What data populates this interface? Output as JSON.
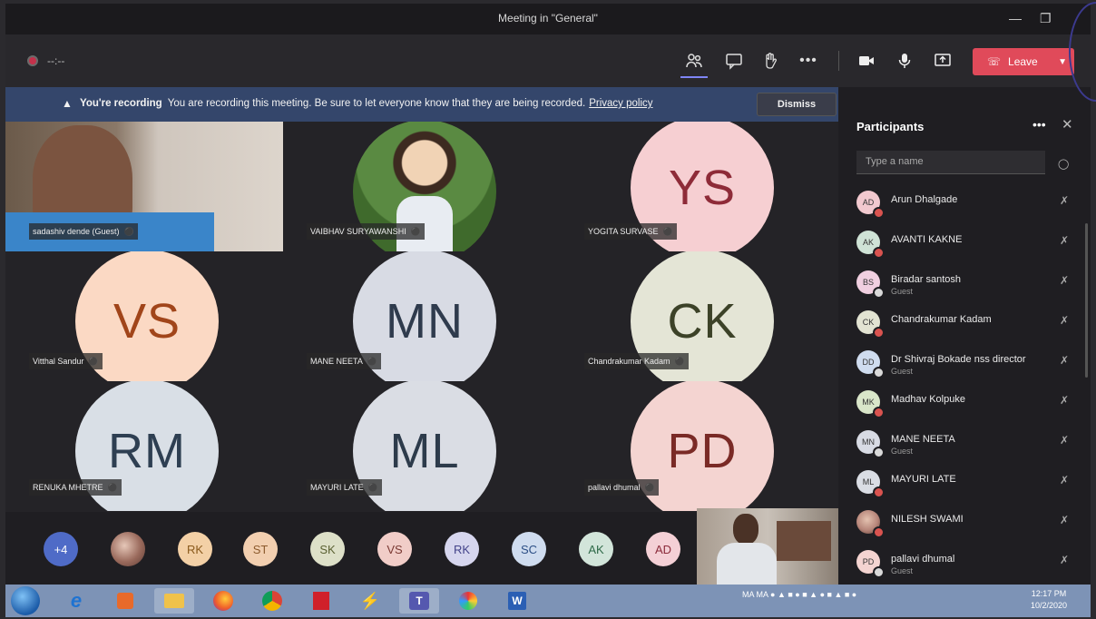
{
  "window": {
    "title": "Meeting in \"General\""
  },
  "toolbar": {
    "leave_label": "Leave"
  },
  "banner": {
    "heading": "You're recording",
    "message": "You are recording this meeting. Be sure to let everyone know that they are being recorded.",
    "link": "Privacy policy",
    "dismiss": "Dismiss"
  },
  "tiles": [
    {
      "name": "sadashiv dende (Guest)",
      "type": "video"
    },
    {
      "name": "VAIBHAV SURYAWANSHI",
      "type": "photo"
    },
    {
      "name": "YOGITA SURVASE",
      "initials": "YS",
      "bg": "#f6cfd2",
      "fg": "#8e2b38"
    },
    {
      "name": "Vitthal Sandur",
      "initials": "VS",
      "bg": "#fbd9c4",
      "fg": "#a1451a"
    },
    {
      "name": "MANE NEETA",
      "initials": "MN",
      "bg": "#d8dbe4",
      "fg": "#2f3b4d"
    },
    {
      "name": "Chandrakumar Kadam",
      "initials": "CK",
      "bg": "#e4e5d6",
      "fg": "#3c4228"
    },
    {
      "name": "RENUKA MHETRE",
      "initials": "RM",
      "bg": "#d9dfe6",
      "fg": "#2e3f52"
    },
    {
      "name": "MAYURI LATE",
      "initials": "ML",
      "bg": "#dadde4",
      "fg": "#2d3b4b"
    },
    {
      "name": "pallavi dhumal",
      "initials": "PD",
      "bg": "#f4d4d1",
      "fg": "#7a2a26"
    }
  ],
  "tray": [
    {
      "label": "+4",
      "bg": "#4f6bc7",
      "fg": "#ffffff"
    },
    {
      "label": "",
      "bg": "#b98c7f",
      "fg": "#ffffff"
    },
    {
      "label": "RK",
      "bg": "#f3d0a6",
      "fg": "#8a5a1c"
    },
    {
      "label": "ST",
      "bg": "#f2cfb0",
      "fg": "#8c5a2d"
    },
    {
      "label": "SK",
      "bg": "#dde0c8",
      "fg": "#5b6133"
    },
    {
      "label": "VS",
      "bg": "#f1cdc8",
      "fg": "#7b3a34"
    },
    {
      "label": "RK",
      "bg": "#d6d6ee",
      "fg": "#44448a"
    },
    {
      "label": "SC",
      "bg": "#cfdcef",
      "fg": "#2d4f86"
    },
    {
      "label": "AK",
      "bg": "#d2e5da",
      "fg": "#2f6a48"
    },
    {
      "label": "AD",
      "bg": "#f4d0d6",
      "fg": "#8a2a3a"
    }
  ],
  "participants": {
    "title": "Participants",
    "search_placeholder": "Type a name",
    "list": [
      {
        "name": "Arun Dhalgade",
        "initials": "AD",
        "sub": "",
        "bg": "#f2c9cf",
        "status": "#d9534f"
      },
      {
        "name": "AVANTI KAKNE",
        "initials": "AK",
        "sub": "",
        "bg": "#cfe3d6",
        "status": "#d9534f"
      },
      {
        "name": "Biradar santosh",
        "initials": "BS",
        "sub": "Guest",
        "bg": "#f0cfe0",
        "status": "#d9d9d9"
      },
      {
        "name": "Chandrakumar Kadam",
        "initials": "CK",
        "sub": "",
        "bg": "#e2e3d2",
        "status": "#d9534f"
      },
      {
        "name": "Dr Shivraj Bokade nss director",
        "initials": "DD",
        "sub": "Guest",
        "bg": "#cfdcef",
        "status": "#d9d9d9"
      },
      {
        "name": "Madhav Kolpuke",
        "initials": "MK",
        "sub": "",
        "bg": "#d9e6c9",
        "status": "#d9534f"
      },
      {
        "name": "MANE NEETA",
        "initials": "MN",
        "sub": "Guest",
        "bg": "#d8dbe4",
        "status": "#d9d9d9"
      },
      {
        "name": "MAYURI LATE",
        "initials": "ML",
        "sub": "",
        "bg": "#dadde4",
        "status": "#d9534f"
      },
      {
        "name": "NILESH SWAMI",
        "initials": "",
        "sub": "",
        "bg": "#b7867a",
        "status": "#d9534f"
      },
      {
        "name": "pallavi dhumal",
        "initials": "PD",
        "sub": "Guest",
        "bg": "#f4d4d1",
        "status": "#d9d9d9"
      }
    ]
  },
  "taskbar": {
    "tray_text": "MA MA",
    "time": "12:17 PM",
    "date": "10/2/2020"
  }
}
